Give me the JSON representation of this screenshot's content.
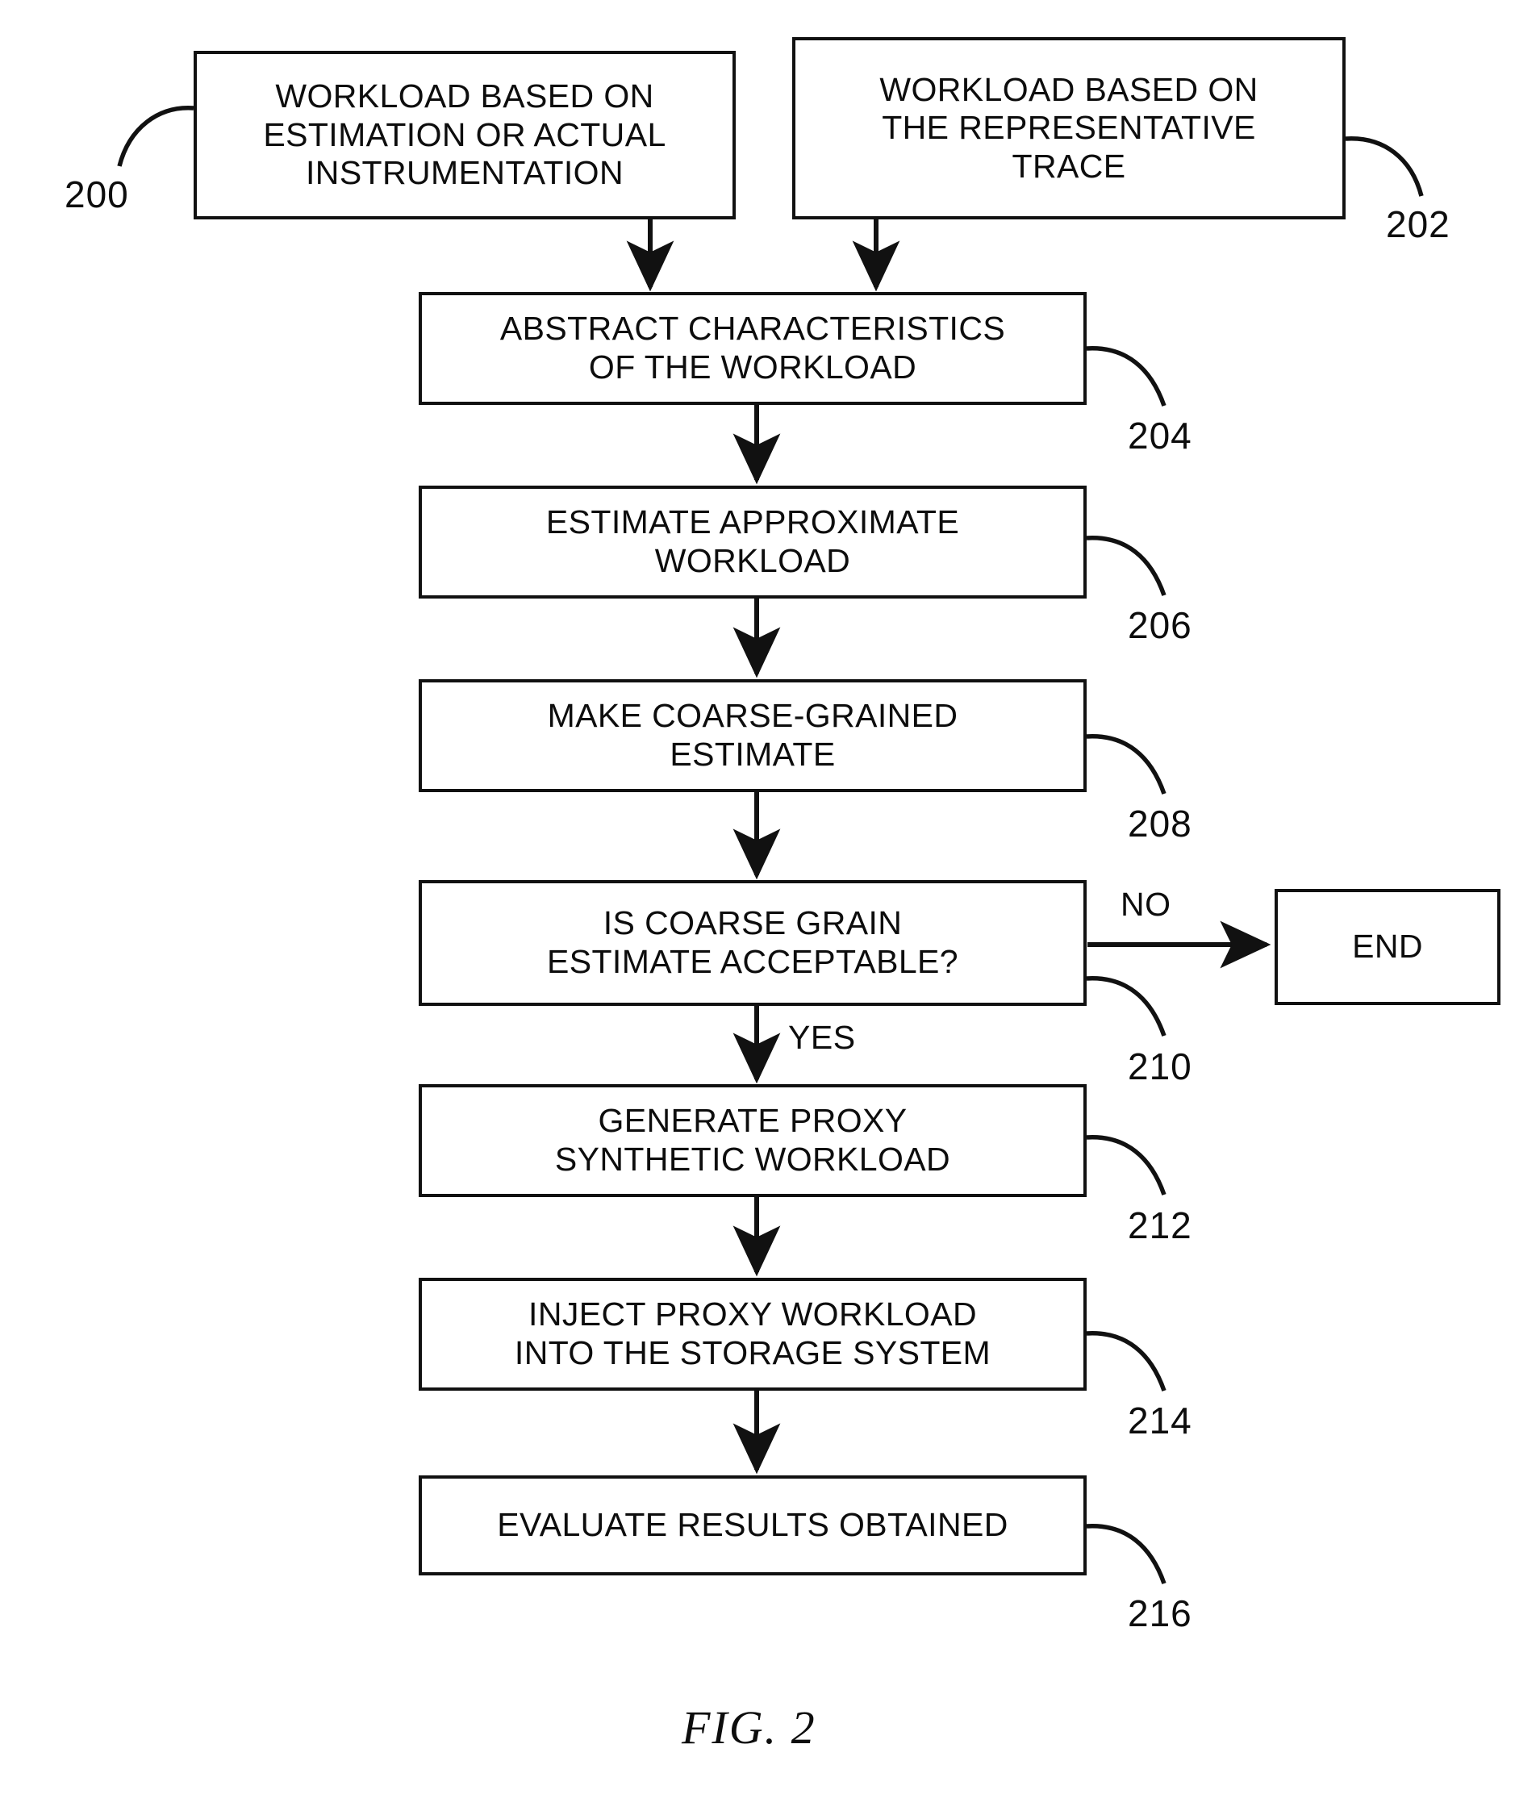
{
  "figure": {
    "caption": "FIG. 2",
    "ink_color": "#111111",
    "background": "#ffffff"
  },
  "nodes": {
    "workload_estimation": {
      "label": "WORKLOAD BASED ON\nESTIMATION OR ACTUAL\nINSTRUMENTATION",
      "ref": "200"
    },
    "workload_trace": {
      "label": "WORKLOAD BASED ON\nTHE REPRESENTATIVE\nTRACE",
      "ref": "202"
    },
    "abstract_characteristics": {
      "label": "ABSTRACT CHARACTERISTICS\nOF THE WORKLOAD",
      "ref": "204"
    },
    "estimate_approximate": {
      "label": "ESTIMATE APPROXIMATE\nWORKLOAD",
      "ref": "206"
    },
    "make_coarse_estimate": {
      "label": "MAKE COARSE-GRAINED\nESTIMATE",
      "ref": "208"
    },
    "decision_coarse_grain": {
      "label": "IS COARSE GRAIN\nESTIMATE ACCEPTABLE?",
      "ref": "210"
    },
    "end": {
      "label": "END"
    },
    "generate_proxy": {
      "label": "GENERATE PROXY\nSYNTHETIC WORKLOAD",
      "ref": "212"
    },
    "inject_proxy": {
      "label": "INJECT PROXY WORKLOAD\nINTO THE STORAGE SYSTEM",
      "ref": "214"
    },
    "evaluate_results": {
      "label": "EVALUATE RESULTS OBTAINED",
      "ref": "216"
    }
  },
  "edges": {
    "no_label": "NO",
    "yes_label": "YES"
  },
  "flowchart_data": {
    "type": "flowchart",
    "title": "FIG. 2",
    "steps": [
      {
        "id": "200",
        "text": "WORKLOAD BASED ON ESTIMATION OR ACTUAL INSTRUMENTATION",
        "shape": "rect"
      },
      {
        "id": "202",
        "text": "WORKLOAD BASED ON THE REPRESENTATIVE TRACE",
        "shape": "rect"
      },
      {
        "id": "204",
        "text": "ABSTRACT CHARACTERISTICS OF THE WORKLOAD",
        "shape": "rect"
      },
      {
        "id": "206",
        "text": "ESTIMATE APPROXIMATE WORKLOAD",
        "shape": "rect"
      },
      {
        "id": "208",
        "text": "MAKE COARSE-GRAINED ESTIMATE",
        "shape": "rect"
      },
      {
        "id": "210",
        "text": "IS COARSE GRAIN ESTIMATE ACCEPTABLE?",
        "shape": "decision"
      },
      {
        "id": "END",
        "text": "END",
        "shape": "rect"
      },
      {
        "id": "212",
        "text": "GENERATE PROXY SYNTHETIC WORKLOAD",
        "shape": "rect"
      },
      {
        "id": "214",
        "text": "INJECT PROXY WORKLOAD INTO THE STORAGE SYSTEM",
        "shape": "rect"
      },
      {
        "id": "216",
        "text": "EVALUATE RESULTS OBTAINED",
        "shape": "rect"
      }
    ],
    "connections": [
      {
        "from": "200",
        "to": "204",
        "label": ""
      },
      {
        "from": "202",
        "to": "204",
        "label": ""
      },
      {
        "from": "204",
        "to": "206",
        "label": ""
      },
      {
        "from": "206",
        "to": "208",
        "label": ""
      },
      {
        "from": "208",
        "to": "210",
        "label": ""
      },
      {
        "from": "210",
        "to": "END",
        "label": "NO"
      },
      {
        "from": "210",
        "to": "212",
        "label": "YES"
      },
      {
        "from": "212",
        "to": "214",
        "label": ""
      },
      {
        "from": "214",
        "to": "216",
        "label": ""
      }
    ]
  }
}
